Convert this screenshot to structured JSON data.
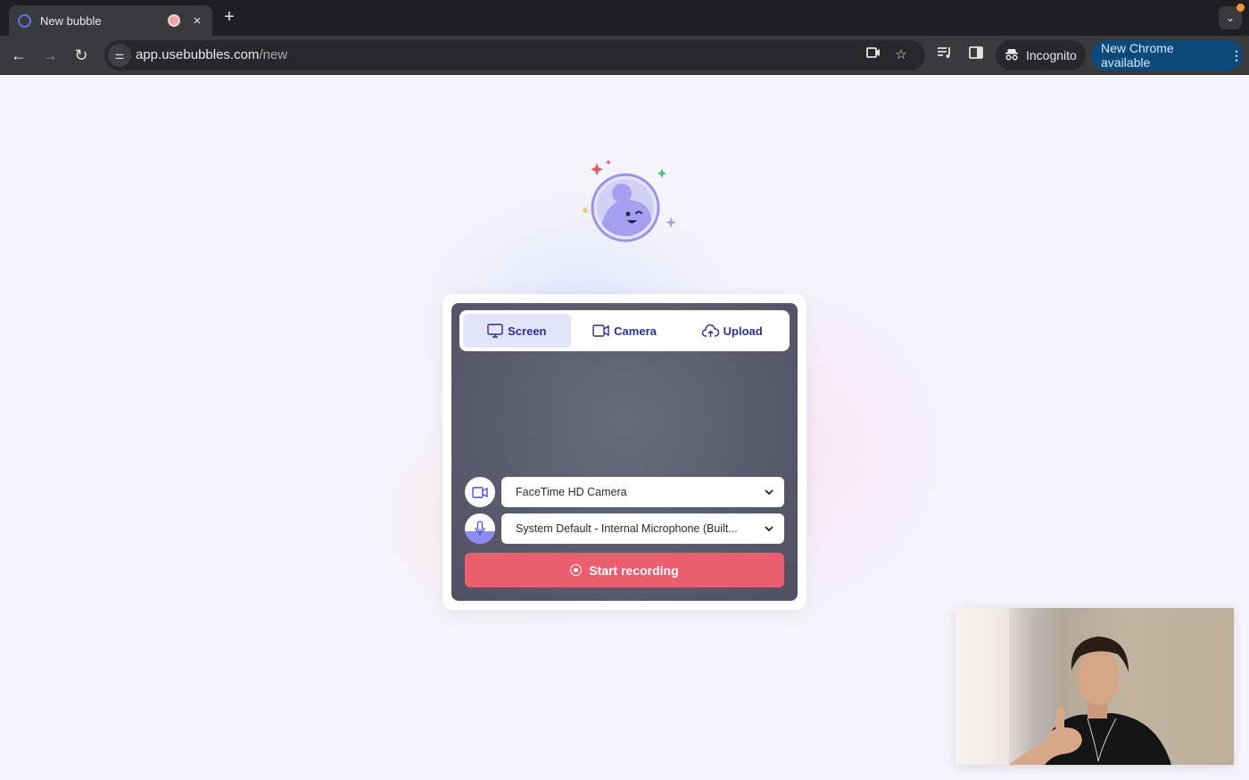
{
  "browser": {
    "tab": {
      "title": "New bubble",
      "favicon": "bubbles-logo-icon",
      "recording_indicator": "recording-icon",
      "close": "×"
    },
    "new_tab": "+",
    "tab_search": "⌄",
    "nav": {
      "back": "←",
      "forward": "→",
      "reload": "↻"
    },
    "url_host": "app.usebubbles.com",
    "url_path": "/new",
    "omnibox_icons": [
      "camera-in-use-icon",
      "bookmark-star-icon"
    ],
    "toolbar_icons": [
      "media-controls-icon",
      "side-panel-icon"
    ],
    "incognito_label": "Incognito",
    "update_label": "New Chrome available"
  },
  "recorder": {
    "mode_tabs": [
      {
        "label": "Screen",
        "icon": "monitor-icon",
        "active": true
      },
      {
        "label": "Camera",
        "icon": "video-camera-icon",
        "active": false
      },
      {
        "label": "Upload",
        "icon": "cloud-upload-icon",
        "active": false
      }
    ],
    "camera_select": {
      "value": "FaceTime HD Camera",
      "icon": "video-camera-icon"
    },
    "mic_select": {
      "value": "System Default - Internal Microphone (Built...",
      "icon": "microphone-icon",
      "level": 0.4
    },
    "start_label": "Start recording"
  },
  "colors": {
    "accent": "#2d2f93",
    "record": "#ea5e70",
    "active_tab_bg": "#e4e5fb",
    "chrome_update": "#0b4a7a"
  }
}
